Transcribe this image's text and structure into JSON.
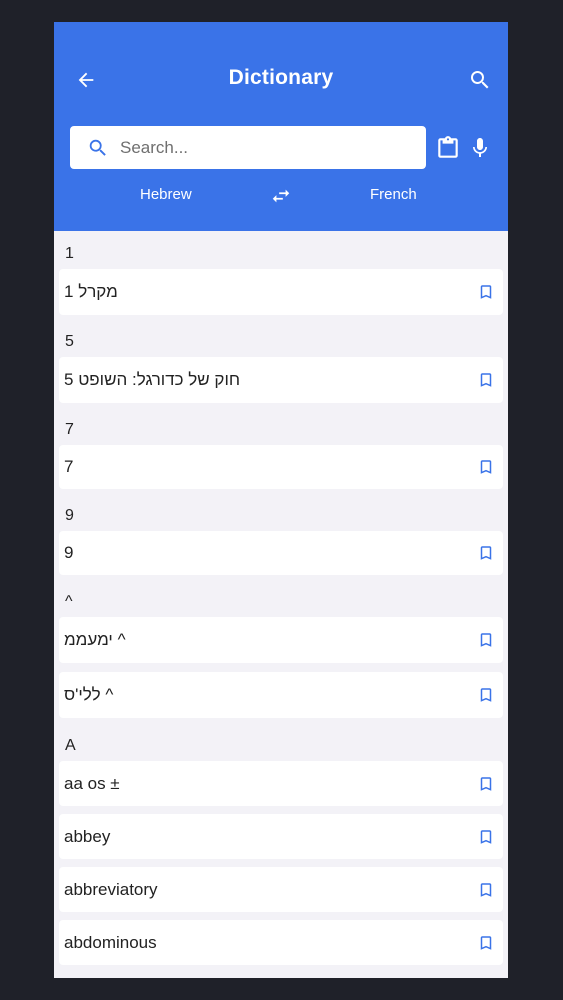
{
  "header": {
    "title": "Dictionary",
    "search_placeholder": "Search...",
    "source_language": "Hebrew",
    "target_language": "French"
  },
  "colors": {
    "primary": "#3a73e8",
    "background": "#f3f2f7",
    "outer": "#1f2129",
    "bookmark": "#3a73e8"
  },
  "entries": [
    {
      "section": "1",
      "words": [
        "מקרל 1"
      ]
    },
    {
      "section": "5",
      "words": [
        "חוק של כדורגל: השופט 5"
      ]
    },
    {
      "section": "7",
      "words": [
        "7"
      ]
    },
    {
      "section": "9",
      "words": [
        "9"
      ]
    },
    {
      "section": "^",
      "words": [
        "ימעממ ^",
        "ללי'ס ^"
      ]
    },
    {
      "section": "A",
      "words": [
        "aa os ±",
        "abbey",
        "abbreviatory",
        "abdominous"
      ]
    }
  ]
}
